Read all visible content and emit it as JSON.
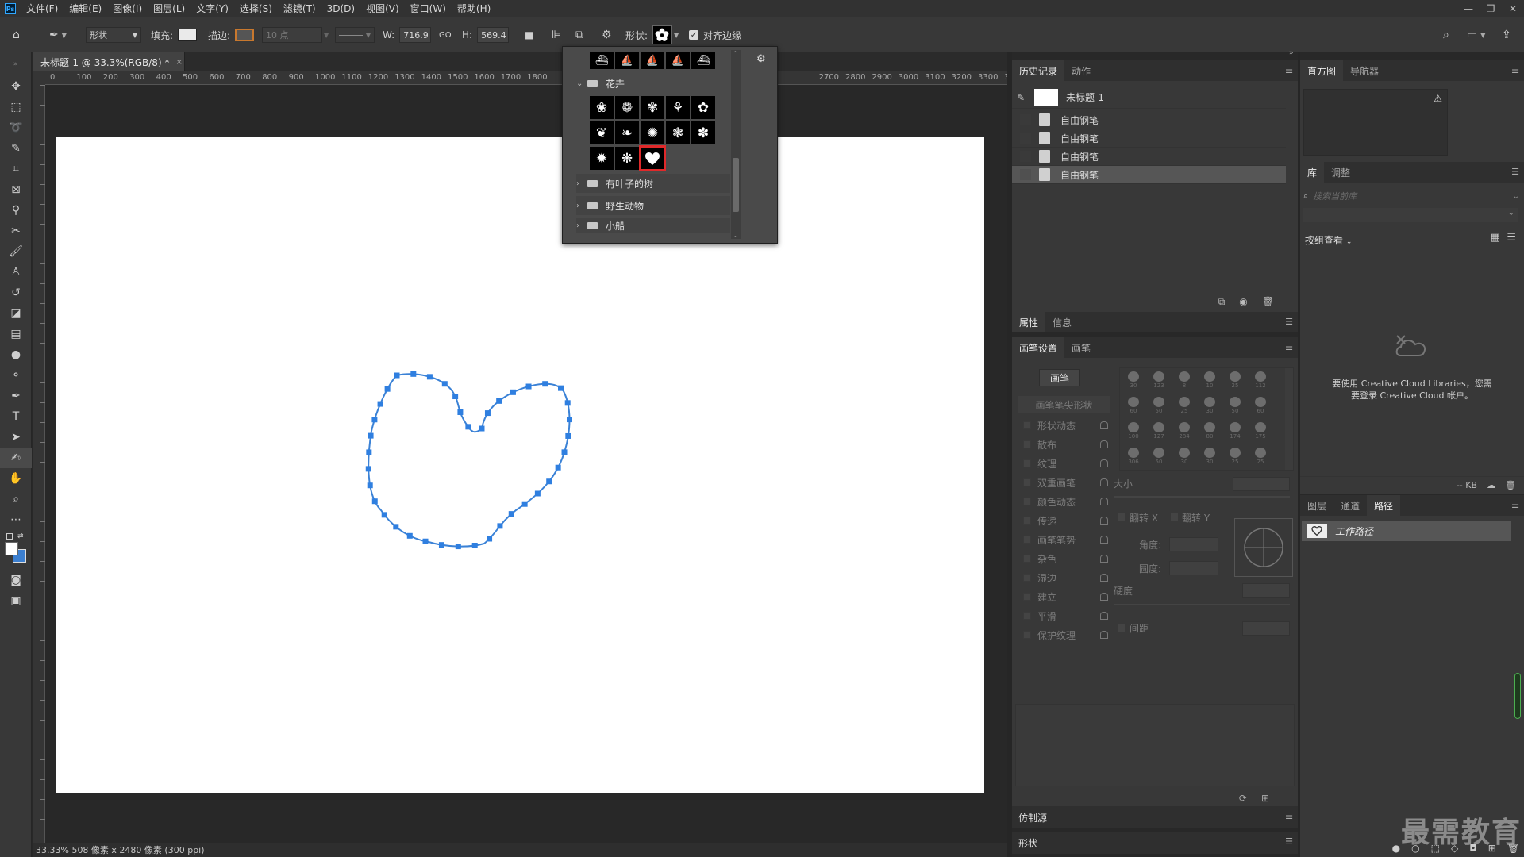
{
  "app": {
    "logo_text": "Ps"
  },
  "menubar": {
    "items": [
      "文件(F)",
      "编辑(E)",
      "图像(I)",
      "图层(L)",
      "文字(Y)",
      "选择(S)",
      "滤镜(T)",
      "3D(D)",
      "视图(V)",
      "窗口(W)",
      "帮助(H)"
    ],
    "window_controls": [
      "—",
      "❐",
      "✕"
    ]
  },
  "options_bar": {
    "mode": "形状",
    "fill_label": "填充:",
    "stroke_label": "描边:",
    "stroke_width": "10 点",
    "width_label": "W:",
    "width_value": "716.9",
    "link_symbol": "GO",
    "height_label": "H:",
    "height_value": "569.4",
    "shape_label": "形状:",
    "align_edges_label": "对齐边缘",
    "align_edges_checked": true
  },
  "document": {
    "tab_title": "未标题-1 @ 33.3%(RGB/8) *",
    "close": "×",
    "ruler_ticks": [
      "0",
      "100",
      "200",
      "300",
      "400",
      "500",
      "600",
      "700",
      "800",
      "900",
      "1000",
      "1100",
      "1200",
      "1300",
      "1400",
      "1500",
      "1600",
      "1700",
      "1800",
      "",
      "",
      "",
      "",
      "",
      "",
      "",
      "",
      "",
      "",
      "2700",
      "2800",
      "2900",
      "3000",
      "3100",
      "3200",
      "3300",
      "3400",
      "35"
    ],
    "status": "33.33%  508 像素 x 2480 像素 (300 ppi)"
  },
  "shape_picker": {
    "folder_open": "花卉",
    "folders_closed": [
      "有叶子的树",
      "野生动物",
      "小船"
    ],
    "selected_shape": "heart-shape"
  },
  "panels": {
    "history": {
      "tabs": [
        "历史记录",
        "动作"
      ],
      "snapshot": "未标题-1",
      "items": [
        "自由钢笔",
        "自由钢笔",
        "自由钢笔",
        "自由钢笔"
      ],
      "selected_index": 3
    },
    "properties": {
      "tabs": [
        "属性",
        "信息"
      ]
    },
    "brush_settings": {
      "tabs": [
        "画笔设置",
        "画笔"
      ],
      "brush_button": "画笔",
      "tip_shape": "画笔笔尖形状",
      "options": [
        "形状动态",
        "散布",
        "纹理",
        "双重画笔",
        "颜色动态",
        "传递",
        "画笔笔势",
        "杂色",
        "湿边",
        "建立",
        "平滑",
        "保护纹理"
      ],
      "size_label": "大小",
      "flip_x": "翻转 X",
      "flip_y": "翻转 Y",
      "angle_label": "角度:",
      "roundness_label": "圆度:",
      "hardness_label": "硬度",
      "spacing_label": "间距",
      "presets": [
        "30",
        "123",
        "8",
        "10",
        "25",
        "112",
        "60",
        "50",
        "25",
        "30",
        "50",
        "60",
        "100",
        "127",
        "284",
        "80",
        "174",
        "175",
        "306",
        "50",
        "30",
        "30",
        "25",
        "25"
      ]
    },
    "clone_source": {
      "title": "仿制源"
    },
    "shapes": {
      "title": "形状"
    },
    "histogram": {
      "tabs": [
        "直方图",
        "导航器"
      ],
      "warning": "⚠"
    },
    "libraries": {
      "tabs": [
        "库",
        "调整"
      ],
      "search_placeholder": "搜索当前库",
      "view_by": "按组查看",
      "message": "要使用 Creative Cloud Libraries，您需要登录 Creative Cloud 帐户。",
      "size": "-- KB"
    },
    "paths": {
      "tabs": [
        "图层",
        "通道",
        "路径"
      ],
      "active_tab": "路径",
      "work_path": "工作路径"
    }
  },
  "watermark": "最需教育"
}
